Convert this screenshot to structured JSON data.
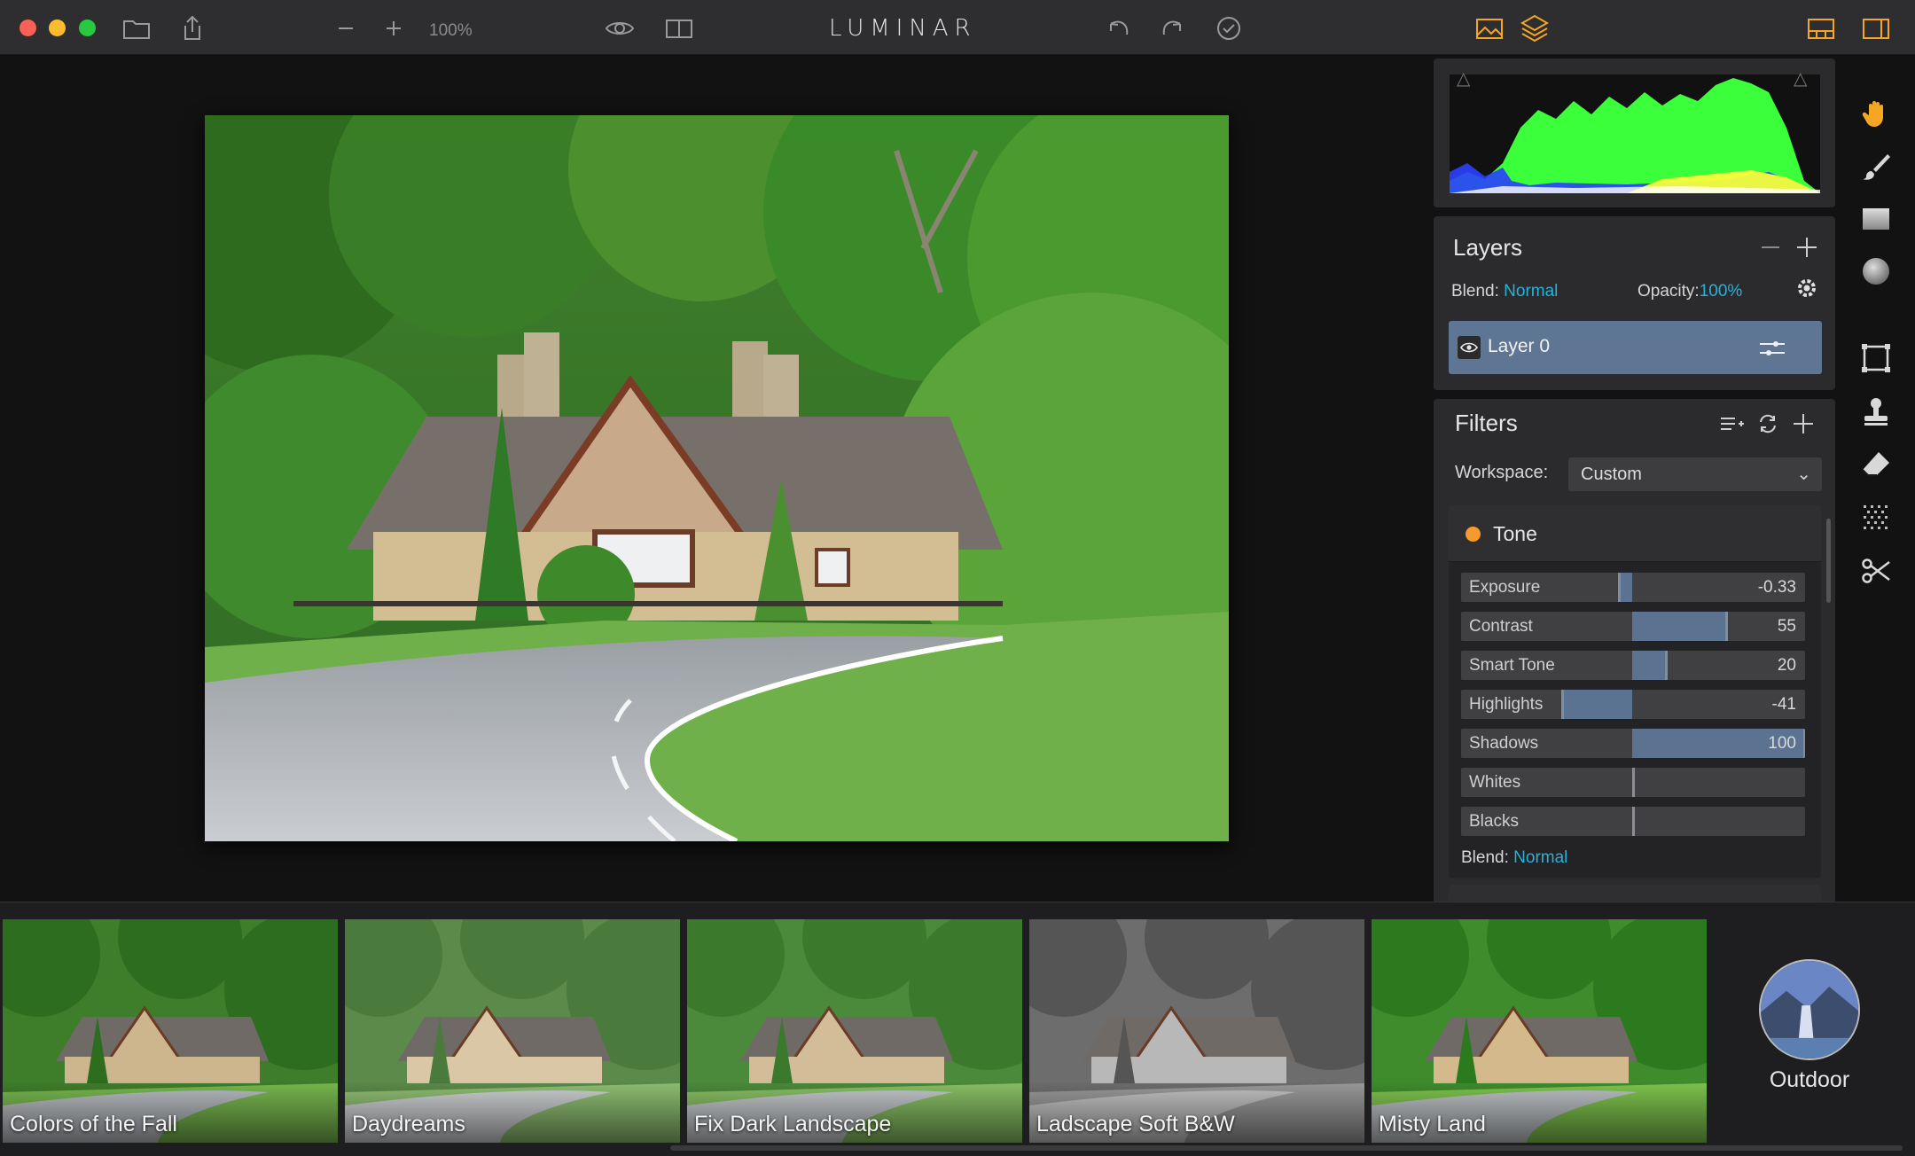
{
  "window": {
    "app_title": "LUMINAR",
    "zoom_level": "100%"
  },
  "layers": {
    "title": "Layers",
    "blend_label": "Blend:",
    "blend_value": "Normal",
    "opacity_label": "Opacity:",
    "opacity_value": "100%",
    "items": [
      {
        "name": "Layer 0"
      }
    ]
  },
  "filters": {
    "title": "Filters",
    "workspace_label": "Workspace:",
    "workspace_value": "Custom",
    "tone": {
      "title": "Tone",
      "sliders": [
        {
          "label": "Exposure",
          "display": "-0.33",
          "value": -0.33,
          "min": -4,
          "max": 4
        },
        {
          "label": "Contrast",
          "display": "55",
          "value": 55,
          "min": -100,
          "max": 100
        },
        {
          "label": "Smart Tone",
          "display": "20",
          "value": 20,
          "min": -100,
          "max": 100
        },
        {
          "label": "Highlights",
          "display": "-41",
          "value": -41,
          "min": -100,
          "max": 100
        },
        {
          "label": "Shadows",
          "display": "100",
          "value": 100,
          "min": -100,
          "max": 100
        },
        {
          "label": "Whites",
          "display": "",
          "value": 0,
          "min": -100,
          "max": 100
        },
        {
          "label": "Blacks",
          "display": "",
          "value": 0,
          "min": -100,
          "max": 100
        }
      ],
      "blend_label": "Blend:",
      "blend_value": "Normal"
    }
  },
  "presets": {
    "items": [
      {
        "name": "Colors of the Fall"
      },
      {
        "name": "Daydreams"
      },
      {
        "name": "Fix Dark Landscape"
      },
      {
        "name": "Ladscape Soft B&W"
      },
      {
        "name": "Misty Land"
      }
    ],
    "category": "Outdoor"
  },
  "colors": {
    "accent": "#29b1d8",
    "tone_dot": "#f79a2e",
    "layer_selected": "#5e7694",
    "toolbar_active": "#f5a623"
  },
  "icons": {
    "titlebar": [
      "folder-icon",
      "share-icon",
      "zoom-out-icon",
      "zoom-in-icon",
      "eye-icon",
      "compare-icon",
      "undo-icon",
      "redo-icon",
      "history-icon",
      "image-icon",
      "layers-icon",
      "filmstrip-icon",
      "sidebar-icon"
    ],
    "tools": [
      "hand-icon",
      "brush-icon",
      "gradient-icon",
      "radial-icon",
      "crop-icon",
      "stamp-icon",
      "eraser-icon",
      "noise-icon",
      "scissors-icon"
    ]
  }
}
